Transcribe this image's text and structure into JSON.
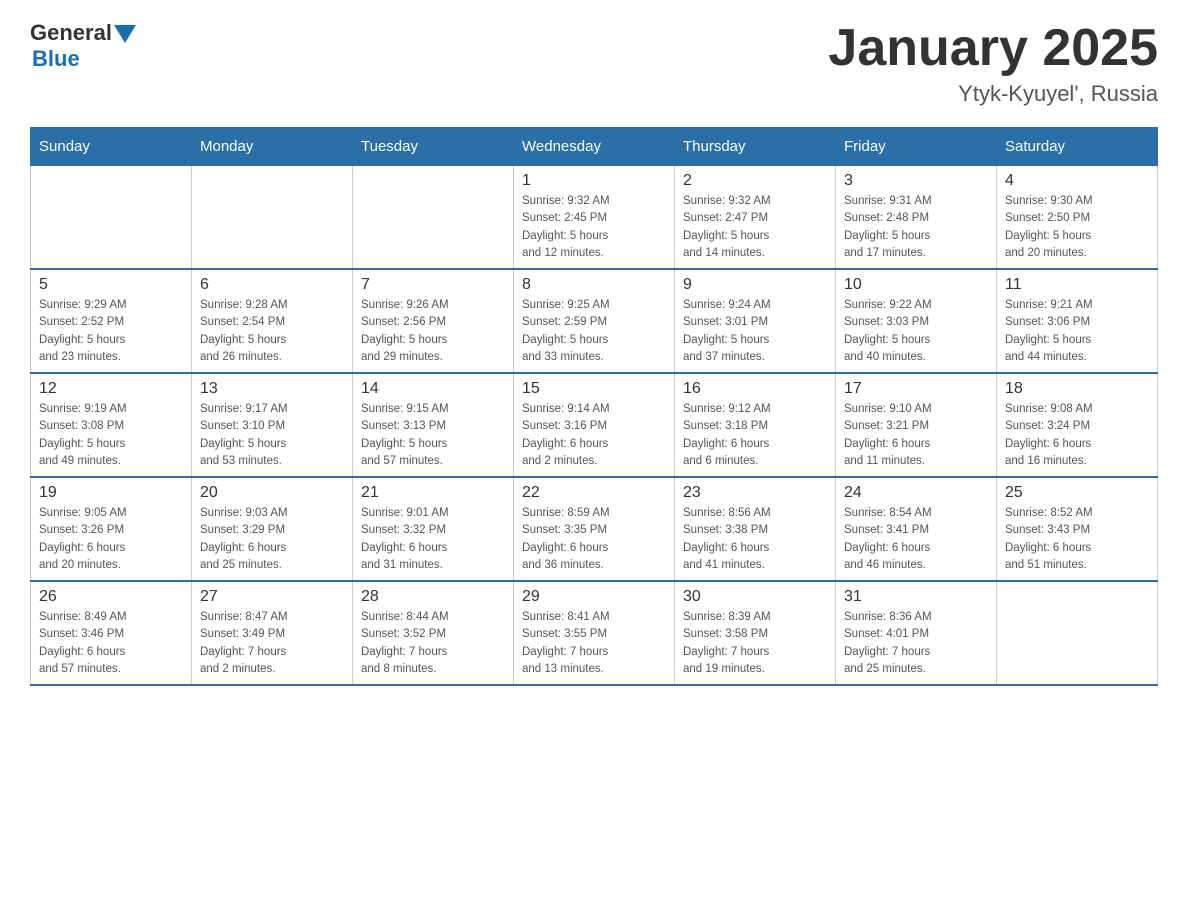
{
  "header": {
    "logo_general": "General",
    "logo_blue": "Blue",
    "title": "January 2025",
    "subtitle": "Ytyk-Kyuyel', Russia"
  },
  "days_of_week": [
    "Sunday",
    "Monday",
    "Tuesday",
    "Wednesday",
    "Thursday",
    "Friday",
    "Saturday"
  ],
  "weeks": [
    {
      "days": [
        {
          "number": "",
          "info": ""
        },
        {
          "number": "",
          "info": ""
        },
        {
          "number": "",
          "info": ""
        },
        {
          "number": "1",
          "info": "Sunrise: 9:32 AM\nSunset: 2:45 PM\nDaylight: 5 hours\nand 12 minutes."
        },
        {
          "number": "2",
          "info": "Sunrise: 9:32 AM\nSunset: 2:47 PM\nDaylight: 5 hours\nand 14 minutes."
        },
        {
          "number": "3",
          "info": "Sunrise: 9:31 AM\nSunset: 2:48 PM\nDaylight: 5 hours\nand 17 minutes."
        },
        {
          "number": "4",
          "info": "Sunrise: 9:30 AM\nSunset: 2:50 PM\nDaylight: 5 hours\nand 20 minutes."
        }
      ]
    },
    {
      "days": [
        {
          "number": "5",
          "info": "Sunrise: 9:29 AM\nSunset: 2:52 PM\nDaylight: 5 hours\nand 23 minutes."
        },
        {
          "number": "6",
          "info": "Sunrise: 9:28 AM\nSunset: 2:54 PM\nDaylight: 5 hours\nand 26 minutes."
        },
        {
          "number": "7",
          "info": "Sunrise: 9:26 AM\nSunset: 2:56 PM\nDaylight: 5 hours\nand 29 minutes."
        },
        {
          "number": "8",
          "info": "Sunrise: 9:25 AM\nSunset: 2:59 PM\nDaylight: 5 hours\nand 33 minutes."
        },
        {
          "number": "9",
          "info": "Sunrise: 9:24 AM\nSunset: 3:01 PM\nDaylight: 5 hours\nand 37 minutes."
        },
        {
          "number": "10",
          "info": "Sunrise: 9:22 AM\nSunset: 3:03 PM\nDaylight: 5 hours\nand 40 minutes."
        },
        {
          "number": "11",
          "info": "Sunrise: 9:21 AM\nSunset: 3:06 PM\nDaylight: 5 hours\nand 44 minutes."
        }
      ]
    },
    {
      "days": [
        {
          "number": "12",
          "info": "Sunrise: 9:19 AM\nSunset: 3:08 PM\nDaylight: 5 hours\nand 49 minutes."
        },
        {
          "number": "13",
          "info": "Sunrise: 9:17 AM\nSunset: 3:10 PM\nDaylight: 5 hours\nand 53 minutes."
        },
        {
          "number": "14",
          "info": "Sunrise: 9:15 AM\nSunset: 3:13 PM\nDaylight: 5 hours\nand 57 minutes."
        },
        {
          "number": "15",
          "info": "Sunrise: 9:14 AM\nSunset: 3:16 PM\nDaylight: 6 hours\nand 2 minutes."
        },
        {
          "number": "16",
          "info": "Sunrise: 9:12 AM\nSunset: 3:18 PM\nDaylight: 6 hours\nand 6 minutes."
        },
        {
          "number": "17",
          "info": "Sunrise: 9:10 AM\nSunset: 3:21 PM\nDaylight: 6 hours\nand 11 minutes."
        },
        {
          "number": "18",
          "info": "Sunrise: 9:08 AM\nSunset: 3:24 PM\nDaylight: 6 hours\nand 16 minutes."
        }
      ]
    },
    {
      "days": [
        {
          "number": "19",
          "info": "Sunrise: 9:05 AM\nSunset: 3:26 PM\nDaylight: 6 hours\nand 20 minutes."
        },
        {
          "number": "20",
          "info": "Sunrise: 9:03 AM\nSunset: 3:29 PM\nDaylight: 6 hours\nand 25 minutes."
        },
        {
          "number": "21",
          "info": "Sunrise: 9:01 AM\nSunset: 3:32 PM\nDaylight: 6 hours\nand 31 minutes."
        },
        {
          "number": "22",
          "info": "Sunrise: 8:59 AM\nSunset: 3:35 PM\nDaylight: 6 hours\nand 36 minutes."
        },
        {
          "number": "23",
          "info": "Sunrise: 8:56 AM\nSunset: 3:38 PM\nDaylight: 6 hours\nand 41 minutes."
        },
        {
          "number": "24",
          "info": "Sunrise: 8:54 AM\nSunset: 3:41 PM\nDaylight: 6 hours\nand 46 minutes."
        },
        {
          "number": "25",
          "info": "Sunrise: 8:52 AM\nSunset: 3:43 PM\nDaylight: 6 hours\nand 51 minutes."
        }
      ]
    },
    {
      "days": [
        {
          "number": "26",
          "info": "Sunrise: 8:49 AM\nSunset: 3:46 PM\nDaylight: 6 hours\nand 57 minutes."
        },
        {
          "number": "27",
          "info": "Sunrise: 8:47 AM\nSunset: 3:49 PM\nDaylight: 7 hours\nand 2 minutes."
        },
        {
          "number": "28",
          "info": "Sunrise: 8:44 AM\nSunset: 3:52 PM\nDaylight: 7 hours\nand 8 minutes."
        },
        {
          "number": "29",
          "info": "Sunrise: 8:41 AM\nSunset: 3:55 PM\nDaylight: 7 hours\nand 13 minutes."
        },
        {
          "number": "30",
          "info": "Sunrise: 8:39 AM\nSunset: 3:58 PM\nDaylight: 7 hours\nand 19 minutes."
        },
        {
          "number": "31",
          "info": "Sunrise: 8:36 AM\nSunset: 4:01 PM\nDaylight: 7 hours\nand 25 minutes."
        },
        {
          "number": "",
          "info": ""
        }
      ]
    }
  ]
}
